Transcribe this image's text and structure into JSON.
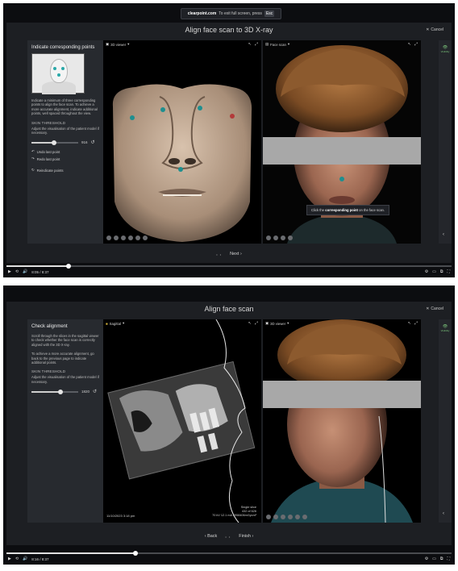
{
  "screenshot1": {
    "notice": {
      "site": "clearpoint.com",
      "text": "To exit full screen, press",
      "key": "Esc"
    },
    "title": "Align face scan to 3D X-ray",
    "cancel": "Cancel",
    "side": {
      "heading": "Indicate corresponding points",
      "description": "Indicate a minimum of three corresponding points to align the face scan. To achieve a more accurate alignment, indicate additional points, well spaced throughout the view.",
      "threshold_label": "SKIN THRESHOLD",
      "threshold_desc": "Adjust the visualisation of the patient model if necessary.",
      "threshold_value": "916",
      "threshold_fraction": 0.48,
      "undo": "Undo last point",
      "redo": "Redo last point",
      "reindicate": "Reindicate points"
    },
    "left_viewer_label": "3D viewer",
    "right_viewer_label": "Face scan",
    "tooltip_prefix": "Click the",
    "tooltip_bold": "corresponding point",
    "tooltip_suffix": "on the face scan.",
    "rightbar_label": "Visibility",
    "next_label": "Next",
    "player": {
      "time": "8:05 / 8:37",
      "progress": 0.14
    }
  },
  "screenshot2": {
    "title": "Align face scan",
    "cancel": "Cancel",
    "side": {
      "heading": "Check alignment",
      "description1": "Scroll through the slices in the sagittal viewer to check whether the face scan is correctly aligned with the 3D X-ray.",
      "description2": "To achieve a more accurate alignment, go back to the previous page to indicate additional points.",
      "threshold_label": "SKIN THRESHOLD",
      "threshold_desc": "Adjust the visualisation of the patient model if necessary.",
      "threshold_value": "1820",
      "threshold_fraction": 0.62
    },
    "left_viewer_label": "Sagittal",
    "right_viewer_label": "3D viewer",
    "date_text": "11/10/2023 3:18 pm",
    "slice_info": [
      "Single slice",
      "432 of 626",
      "70 kV 12.1 mA 2958406mGycm²"
    ],
    "rightbar_label": "Visibility",
    "back_label": "Back",
    "finish_label": "Finish",
    "player": {
      "time": "8:16 / 8:37",
      "progress": 0.29
    }
  }
}
